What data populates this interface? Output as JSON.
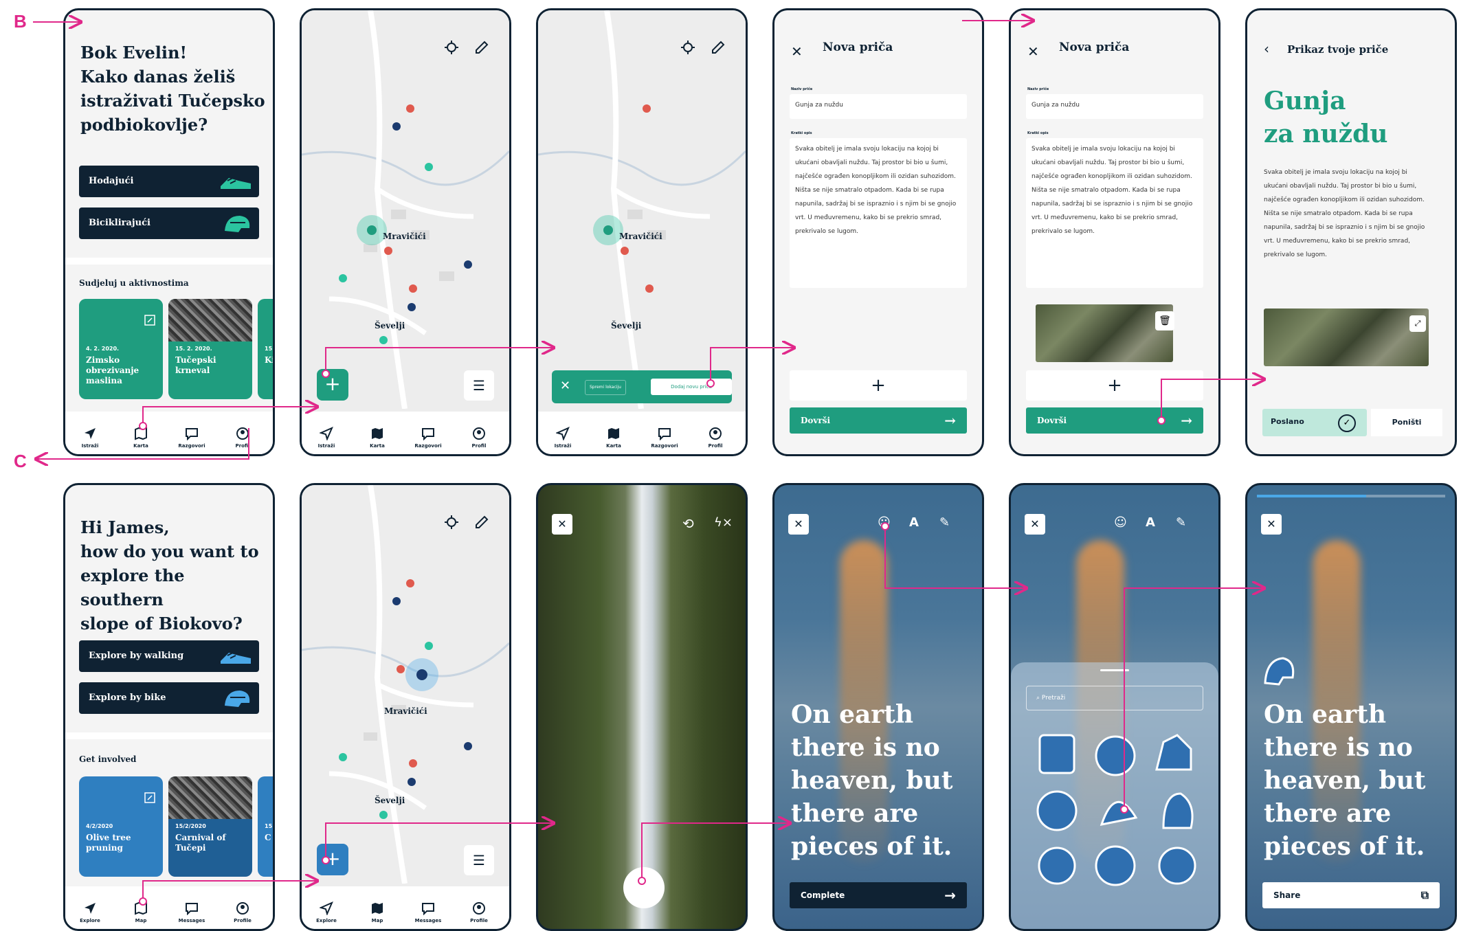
{
  "labels": {
    "b": "B",
    "c": "C"
  },
  "hr": {
    "greeting": [
      "Bok Evelin!",
      "Kako danas želiš",
      "istraživati Tučepsko",
      "podbiokovlje?"
    ],
    "walk": "Hodajući",
    "bike": "Biciklirajući",
    "section": "Sudjeluj u aktivnostima",
    "cards": [
      {
        "date": "4. 2. 2020.",
        "title": "Zimsko obrezivanje maslina"
      },
      {
        "date": "15. 2. 2020.",
        "title": "Tučepski krneval"
      },
      {
        "date": "15",
        "title": "Ki ba"
      }
    ],
    "tabs": [
      "Istraži",
      "Karta",
      "Razgovori",
      "Profil"
    ],
    "map_places": [
      "Mravičići",
      "Ševelji"
    ],
    "story_bar": {
      "left": "Spremi lokaciju",
      "right": "Dodaj novu priču"
    },
    "form_title": "Nova priča",
    "form_name_label": "Naziv priče",
    "form_name_value": "Gunja za nuždu",
    "form_desc_label": "Kratki opis",
    "form_desc": "Svaka obitelj je imala svoju lokaciju na kojoj bi ukućani obavljali nuždu. Taj prostor bi bio u šumi, najčešće ograđen konopljikom ili ozidan suhozidom. Ništa se nije smatralo otpadom. Kada bi se rupa napunila, sadržaj bi se ispraznio i s njim bi se gnojio vrt. U međuvremenu, kako bi se prekrio smrad, prekrivalo se lugom.",
    "plus": "+",
    "finish": "Dovrši",
    "preview_title": "Prikaz tvoje priče",
    "preview_big": [
      "Gunja",
      "za nuždu"
    ],
    "sent": "Poslano",
    "cancel": "Poništi"
  },
  "en": {
    "greeting": [
      "Hi James,",
      "how do you want to",
      "explore the southern",
      "slope of Biokovo?"
    ],
    "walk": "Explore by walking",
    "bike": "Explore by bike",
    "section": "Get involved",
    "cards": [
      {
        "date": "4/2/2020",
        "title": "Olive tree pruning"
      },
      {
        "date": "15/2/2020",
        "title": "Carnival of Tučepi"
      },
      {
        "date": "15",
        "title": "C w"
      }
    ],
    "tabs": [
      "Explore",
      "Map",
      "Messages",
      "Profile"
    ],
    "quote": [
      "On earth",
      "there is no",
      "heaven, but",
      "there are",
      "pieces of it."
    ],
    "complete": "Complete",
    "share": "Share",
    "search_placeholder": "Pretraži"
  },
  "colors": {
    "teal": "#1f9d7f",
    "blue": "#2f7fc0",
    "navy": "#0f2233",
    "magenta": "#e0288a"
  }
}
